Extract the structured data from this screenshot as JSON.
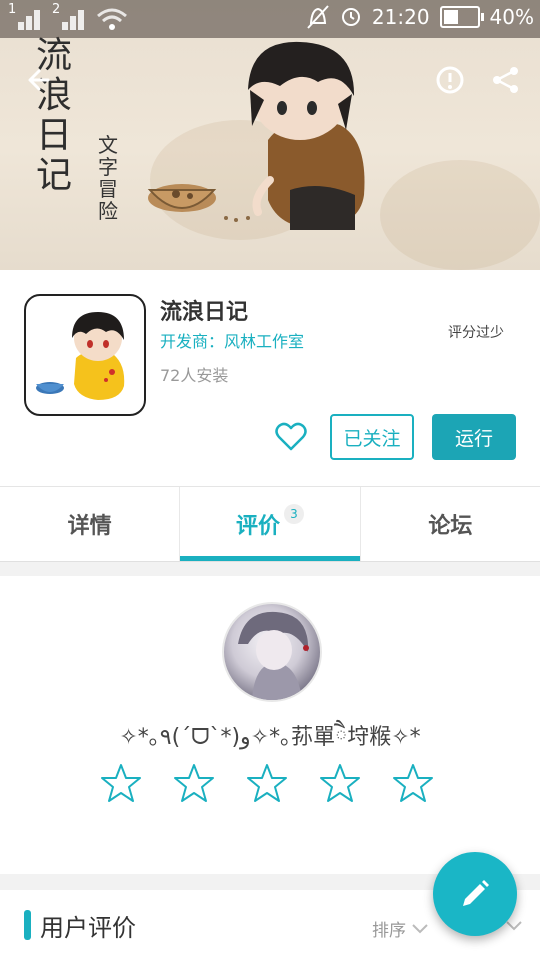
{
  "status_bar": {
    "sim1": "1",
    "sim2": "2",
    "time": "21:20",
    "battery": "40%"
  },
  "hero": {
    "title": "流浪日记",
    "subtitle": "文字冒险"
  },
  "app": {
    "name": "流浪日记",
    "developer": "开发商：风林工作室",
    "installs": "72人安装",
    "rating_note": "评分过少",
    "follow_label": "已关注",
    "run_label": "运行"
  },
  "tabs": [
    {
      "label": "详情"
    },
    {
      "label": "评价",
      "badge": "3"
    },
    {
      "label": "论坛"
    }
  ],
  "review": {
    "nickname": "✧*｡٩(ˊᗜˋ*)و✧*｡荪單ཻ垨糇✧*",
    "star_count": 5,
    "rating": 0
  },
  "user_reviews": {
    "title": "用户评价",
    "sort_label": "排序"
  },
  "colors": {
    "accent": "#1ab0c0",
    "run_button": "#1ca5b5",
    "fab": "#1ab6c6"
  },
  "icons": [
    "back-arrow-icon",
    "report-icon",
    "share-icon",
    "heart-icon",
    "star-outline-icon",
    "edit-pencil-icon",
    "chevron-down-icon"
  ]
}
